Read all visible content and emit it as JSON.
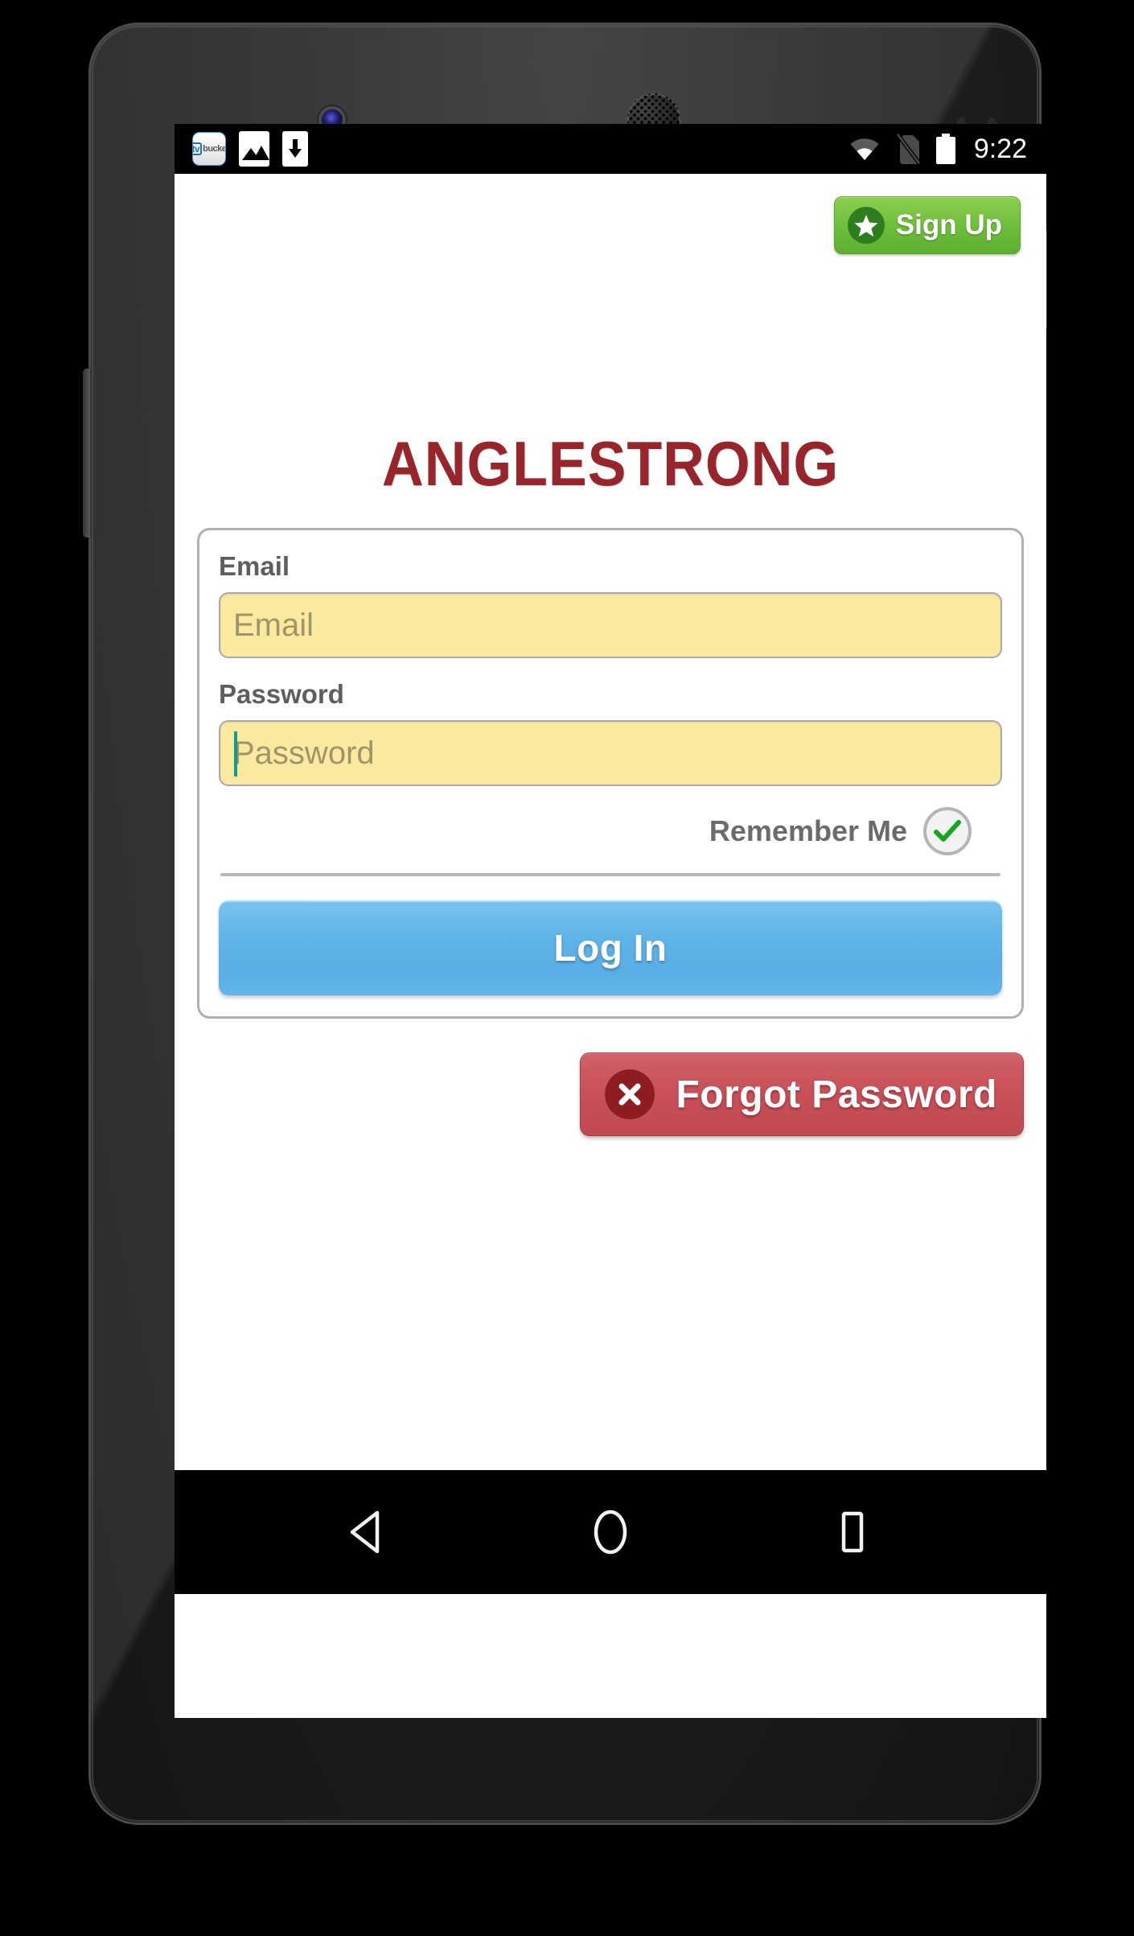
{
  "status_bar": {
    "icons_left": [
      "tvbucket-app-icon",
      "image-icon",
      "download-icon"
    ],
    "tvbucket_tv": "tv",
    "tvbucket_text": "bucket",
    "icons_right": [
      "wifi-icon",
      "no-sim-icon",
      "battery-full-icon"
    ],
    "time": "9:22"
  },
  "app": {
    "brand_title": "ANGLESTRONG",
    "signup": {
      "label": "Sign Up",
      "icon": "star-icon",
      "bg_color": "#6cbe3a",
      "icon_circle_color": "#2f7d1e"
    },
    "form": {
      "email": {
        "label": "Email",
        "placeholder": "Email",
        "value": ""
      },
      "password": {
        "label": "Password",
        "placeholder": "Password",
        "value": "",
        "focused": true,
        "caret_color": "#0f9b90"
      },
      "remember_me": {
        "label": "Remember Me",
        "checked": true,
        "check_color": "#16a522"
      },
      "login_button": {
        "label": "Log In",
        "bg_color": "#5fb3e8"
      }
    },
    "forgot_password": {
      "label": "Forgot Password",
      "icon": "x-icon",
      "bg_color": "#c95159",
      "icon_circle_color": "#8e1d22"
    },
    "field_bg_color": "#fbe9a0",
    "brand_color": "#97252a"
  },
  "nav_bar": {
    "back": "back-triangle-icon",
    "home": "home-circle-icon",
    "recents": "recents-square-icon"
  }
}
